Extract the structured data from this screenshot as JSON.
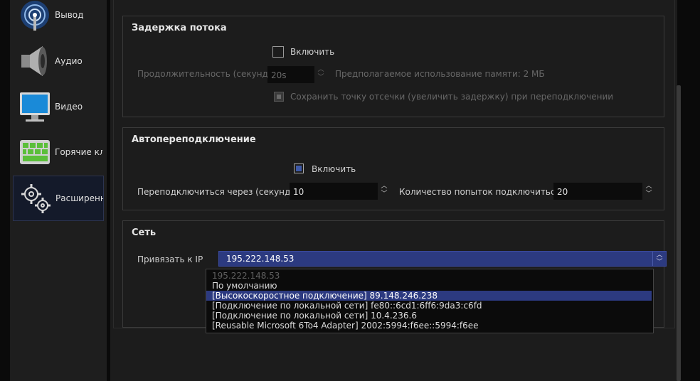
{
  "sidebar": {
    "items": [
      {
        "label": "Вывод",
        "icon": "broadcast-icon"
      },
      {
        "label": "Аудио",
        "icon": "speaker-icon"
      },
      {
        "label": "Видео",
        "icon": "monitor-icon"
      },
      {
        "label": "Горячие кла",
        "icon": "keyboard-icon"
      },
      {
        "label": "Расширенны",
        "icon": "gears-icon"
      }
    ]
  },
  "stream_delay": {
    "title": "Задержка потока",
    "enable_label": "Включить",
    "duration_label": "Продолжительность (секунд)",
    "duration_value": "20s",
    "memory_label": "Предполагаемое использование памяти: 2 МБ",
    "preserve_label": "Сохранить точку отсечки (увеличить задержку) при переподключении"
  },
  "reconnect": {
    "title": "Автопереподключение",
    "enable_label": "Включить",
    "retry_delay_label": "Переподключиться через (секунд)",
    "retry_delay_value": "10",
    "max_retries_label": "Количество попыток подключиться",
    "max_retries_value": "20"
  },
  "network": {
    "title": "Сеть",
    "bind_ip_label": "Привязать к IP",
    "bind_ip_value": "195.222.148.53",
    "options": [
      "195.222.148.53",
      "По умолчанию",
      "[Высокоскоростное подключение] 89.148.246.238",
      "[Подключение по локальной сети] fe80::6cd1:6ff6:9da3:c6fd",
      "[Подключение по локальной сети] 10.4.236.6",
      "[Reusable Microsoft 6To4 Adapter] 2002:5994:f6ee::5994:f6ee"
    ]
  },
  "colors": {
    "accent": "#2c3a80",
    "background": "#1c1c1c"
  }
}
